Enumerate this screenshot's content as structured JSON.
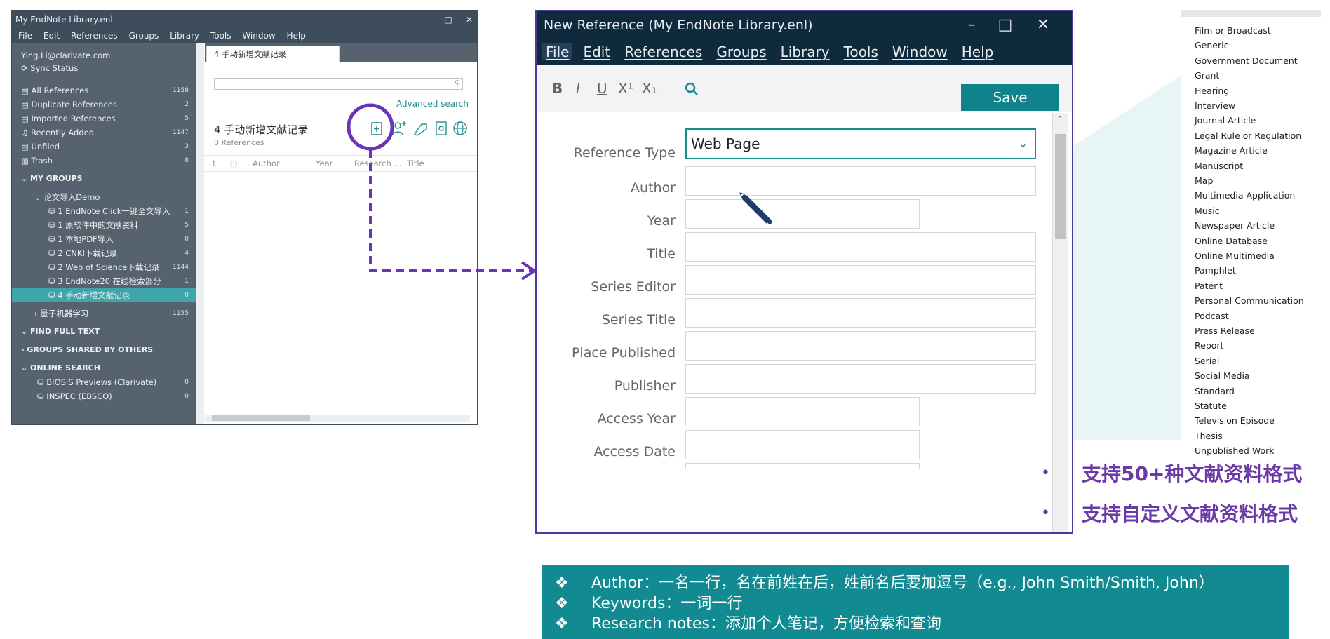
{
  "left_window": {
    "title": "My EndNote Library.enl",
    "window_controls": {
      "minimize": "–",
      "maximize": "□",
      "close": "✕"
    },
    "menu": [
      "File",
      "Edit",
      "References",
      "Groups",
      "Library",
      "Tools",
      "Window",
      "Help"
    ],
    "account": "Ying.Li@clarivate.com",
    "sync_status": "Sync Status",
    "library_items": [
      {
        "label": "All References",
        "count": "1158"
      },
      {
        "label": "Duplicate References",
        "count": "2"
      },
      {
        "label": "Imported References",
        "count": "5"
      },
      {
        "label": "Recently Added",
        "count": "1147"
      },
      {
        "label": "Unfiled",
        "count": "3"
      },
      {
        "label": "Trash",
        "count": "8"
      }
    ],
    "my_groups_header": "MY GROUPS",
    "group_set": "论文导入Demo",
    "groups": [
      {
        "label": "1 EndNote Click一键全文导入",
        "count": "1"
      },
      {
        "label": "1 原软件中的文献资料",
        "count": "5"
      },
      {
        "label": "1 本地PDF导入",
        "count": "0"
      },
      {
        "label": "2 CNKI下载记录",
        "count": "4"
      },
      {
        "label": "2 Web of Science下载记录",
        "count": "1144"
      },
      {
        "label": "3 EndNote20 在线检索部分",
        "count": "1"
      },
      {
        "label": "4 手动新增文献记录",
        "count": "0"
      }
    ],
    "other_group": {
      "label": "量子机器学习",
      "count": "1155"
    },
    "find_full_text": "FIND FULL TEXT",
    "groups_shared": "GROUPS SHARED BY OTHERS",
    "online_search": "ONLINE SEARCH",
    "online_items": [
      {
        "label": "BIOSIS Previews (Clarivate)",
        "count": "0"
      },
      {
        "label": "INSPEC (EBSCO)",
        "count": "0"
      }
    ],
    "tab_label": "4 手动新增文献记录",
    "advanced_search": "Advanced search",
    "group_title": "4 手动新增文献记录",
    "references_count": "0 References",
    "columns": [
      "Author",
      "Year",
      "Research ...",
      "Title"
    ]
  },
  "ref_window": {
    "title": "New Reference (My EndNote Library.enl)",
    "window_controls": {
      "minimize": "–",
      "maximize": "□",
      "close": "✕"
    },
    "menu": [
      "File",
      "Edit",
      "References",
      "Groups",
      "Library",
      "Tools",
      "Window",
      "Help"
    ],
    "format_buttons": {
      "bold": "B",
      "italic": "I",
      "underline": "U",
      "superscript": "X¹",
      "subscript": "X₁"
    },
    "save_label": "Save",
    "reference_type_label": "Reference Type",
    "reference_type_value": "Web Page",
    "fields": [
      "Author",
      "Year",
      "Title",
      "Series Editor",
      "Series Title",
      "Place Published",
      "Publisher",
      "Access Year",
      "Access Date"
    ]
  },
  "ref_type_list": [
    "Film or Broadcast",
    "Generic",
    "Government Document",
    "Grant",
    "Hearing",
    "Interview",
    "Journal Article",
    "Legal Rule or Regulation",
    "Magazine Article",
    "Manuscript",
    "Map",
    "Multimedia Application",
    "Music",
    "Newspaper Article",
    "Online Database",
    "Online Multimedia",
    "Pamphlet",
    "Patent",
    "Personal Communication",
    "Podcast",
    "Press Release",
    "Report",
    "Serial",
    "Social Media",
    "Standard",
    "Statute",
    "Television Episode",
    "Thesis",
    "Unpublished Work"
  ],
  "bullets": [
    "支持50+种文献资料格式",
    "支持自定义文献资料格式"
  ],
  "notes": [
    "Author：一名一行，名在前姓在后，姓前名后要加逗号（e.g., John Smith/Smith, John）",
    "Keywords：一词一行",
    "Research notes：添加个人笔记，方便检索和查询"
  ],
  "note_bullet": "❖",
  "colors": {
    "accent_teal": "#118a92",
    "highlight_purple": "#6b3aa8",
    "dark_title": "#0f2a3c",
    "sidebar": "#56626d"
  }
}
